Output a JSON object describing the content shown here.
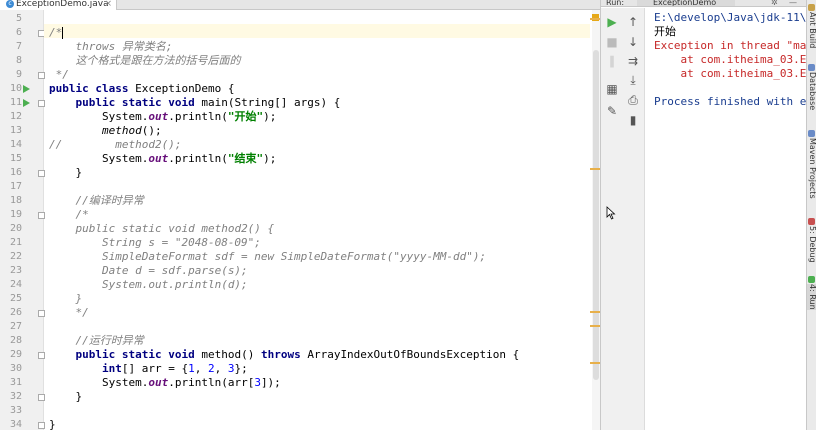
{
  "editor": {
    "tab": {
      "label": "ExceptionDemo.java",
      "close": "×"
    },
    "lines": [
      {
        "n": "5",
        "html": ""
      },
      {
        "n": "6",
        "html": "<span class=\"cm\">/*</span>"
      },
      {
        "n": "7",
        "html": "<span class=\"cm\">    throws 异常类名;</span>"
      },
      {
        "n": "8",
        "html": "<span class=\"cm\">    这个格式是跟在方法的括号后面的</span>"
      },
      {
        "n": "9",
        "html": "<span class=\"cm\"> */</span>"
      },
      {
        "n": "10",
        "html": "<span class=\"kw\">public class</span> ExceptionDemo {"
      },
      {
        "n": "11",
        "html": "    <span class=\"kw\">public static void</span> main(String[] args) {"
      },
      {
        "n": "12",
        "html": "        System.<span class=\"fld\">out</span>.println(<span class=\"str\">\"开始\"</span>);"
      },
      {
        "n": "13",
        "html": "        <span class=\"it\">method</span>();"
      },
      {
        "n": "14",
        "html": "<span class=\"cm\">//        method2();</span>"
      },
      {
        "n": "15",
        "html": "        System.<span class=\"fld\">out</span>.println(<span class=\"str\">\"结束\"</span>);"
      },
      {
        "n": "16",
        "html": "    }"
      },
      {
        "n": "17",
        "html": ""
      },
      {
        "n": "18",
        "html": "    <span class=\"cm\">//编译时异常</span>"
      },
      {
        "n": "19",
        "html": "    <span class=\"cm\">/*</span>"
      },
      {
        "n": "20",
        "html": "    <span class=\"cm\">public static void method2() {</span>"
      },
      {
        "n": "21",
        "html": "        <span class=\"cm\">String s = \"2048-08-09\";</span>"
      },
      {
        "n": "22",
        "html": "        <span class=\"cm\">SimpleDateFormat sdf = new SimpleDateFormat(\"yyyy-MM-dd\");</span>"
      },
      {
        "n": "23",
        "html": "        <span class=\"cm\">Date d = sdf.parse(s);</span>"
      },
      {
        "n": "24",
        "html": "        <span class=\"cm\">System.out.println(d);</span>"
      },
      {
        "n": "25",
        "html": "    <span class=\"cm\">}</span>"
      },
      {
        "n": "26",
        "html": "    <span class=\"cm\">*/</span>"
      },
      {
        "n": "27",
        "html": ""
      },
      {
        "n": "28",
        "html": "    <span class=\"cm\">//运行时异常</span>"
      },
      {
        "n": "29",
        "html": "    <span class=\"kw\">public static void</span> method() <span class=\"kw\">throws</span> ArrayIndexOutOfBoundsException {"
      },
      {
        "n": "30",
        "html": "        <span class=\"kw\">int</span>[] arr = {<span class=\"num\">1</span>, <span class=\"num\">2</span>, <span class=\"num\">3</span>};"
      },
      {
        "n": "31",
        "html": "        System.<span class=\"fld\">out</span>.println(arr[<span class=\"num\">3</span>]);"
      },
      {
        "n": "32",
        "html": "    }"
      },
      {
        "n": "33",
        "html": ""
      },
      {
        "n": "34",
        "html": "}"
      }
    ]
  },
  "run": {
    "label": "Run:",
    "tab": "ExceptionDemo",
    "gear": "✲",
    "minimize": "—",
    "console": [
      "E:\\develop\\Java\\jdk-11\\",
      "开始",
      "Exception in thread \"ma",
      "    at com.itheima_03.E",
      "    at com.itheima_03.E",
      "",
      "Process finished with e"
    ]
  },
  "right_strip": [
    "Ant Build",
    "Database",
    "Maven Projects",
    "5: Debug",
    "4: Run"
  ],
  "colors": {
    "keyword": "#000080",
    "string": "#008000",
    "comment": "#808080",
    "number": "#0000ff",
    "error": "#c62828",
    "run_green": "#4caf50"
  }
}
